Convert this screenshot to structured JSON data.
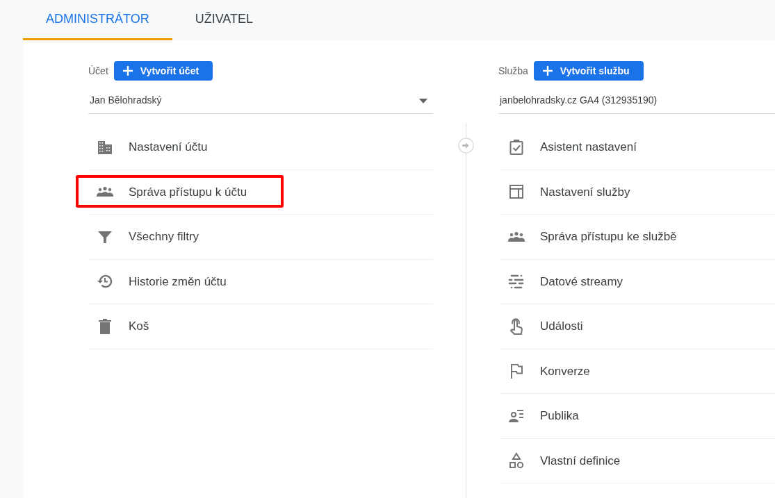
{
  "tabs": [
    {
      "label": "ADMINISTRÁTOR",
      "selected": true
    },
    {
      "label": "UŽIVATEL",
      "selected": false
    }
  ],
  "account": {
    "label": "Účet",
    "create_button": "Vytvořit účet",
    "selector": {
      "value": "Jan Bělohradský",
      "dropdown_arrow": true
    },
    "items": [
      {
        "label": "Nastavení účtu",
        "highlighted": false
      },
      {
        "label": "Správa přístupu k účtu",
        "highlighted": true
      },
      {
        "label": "Všechny filtry",
        "highlighted": false
      },
      {
        "label": "Historie změn účtu",
        "highlighted": false
      },
      {
        "label": "Koš",
        "highlighted": false
      }
    ]
  },
  "property": {
    "label": "Služba",
    "create_button": "Vytvořit službu",
    "selector": {
      "value": "janbelohradsky.cz GA4 (312935190)",
      "dropdown_arrow": false
    },
    "items": [
      {
        "label": "Asistent nastavení",
        "highlighted": false
      },
      {
        "label": "Nastavení služby",
        "highlighted": false
      },
      {
        "label": "Správa přístupu ke službě",
        "highlighted": false
      },
      {
        "label": "Datové streamy",
        "highlighted": false
      },
      {
        "label": "Události",
        "highlighted": false
      },
      {
        "label": "Konverze",
        "highlighted": false
      },
      {
        "label": "Publika",
        "highlighted": false
      },
      {
        "label": "Vlastní definice",
        "highlighted": false
      }
    ]
  }
}
